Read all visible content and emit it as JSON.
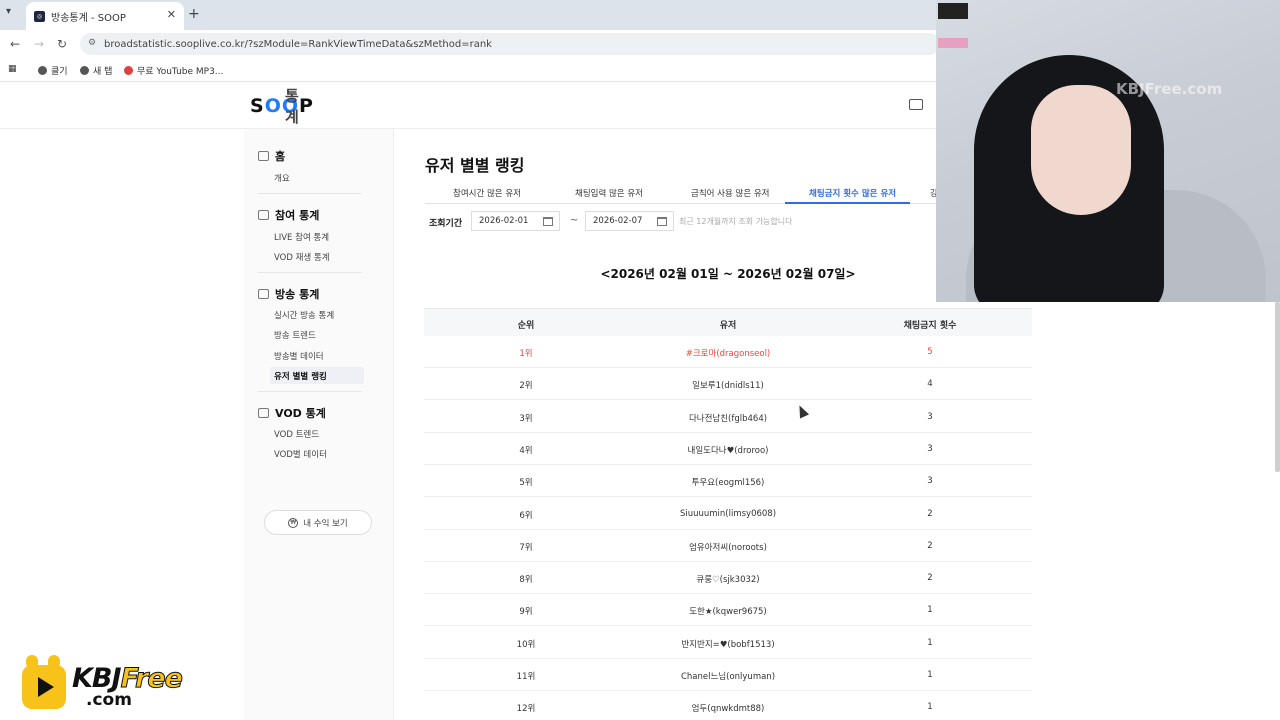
{
  "browser": {
    "tab_title": "방송통계 - SOOP",
    "url": "broadstatistic.sooplive.co.kr/?szModule=RankViewTimeData&szMethod=rank",
    "bookmarks": [
      "앱",
      "클기",
      "새 탭",
      "무료 YouTube MP3..."
    ]
  },
  "site": {
    "logo_text": "SOOP",
    "logo_sub": "통계"
  },
  "sidebar": {
    "sections": [
      {
        "title": "홈",
        "items": [
          "개요"
        ]
      },
      {
        "title": "참여 통계",
        "items": [
          "LIVE 참여 통계",
          "VOD 재생 통계"
        ]
      },
      {
        "title": "방송 통계",
        "items": [
          "실시간 방송 통계",
          "방송 트렌드",
          "방송별 데이터",
          "유저 별별 랭킹"
        ]
      },
      {
        "title": "VOD 통계",
        "items": [
          "VOD 트렌드",
          "VOD별 데이터"
        ]
      }
    ],
    "active_item": "유저 별별 랭킹",
    "revenue_button": "내 수익 보기"
  },
  "main": {
    "title": "유저 별별 랭킹",
    "tabs": [
      "참여시간 많은 유저",
      "채팅입력 많은 유저",
      "금칙어 사용 많은 유저",
      "채팅금지 횟수 많은 유저",
      "강"
    ],
    "active_tab": "채팅금지 횟수 많은 유저",
    "period_label": "조회기간",
    "start_date": "2026-02-01",
    "end_date": "2026-02-07",
    "date_separator": "~",
    "hint": "최근 12개월까지 조회 가능합니다",
    "range_heading": "<2026년 02월 01일 ~ 2026년 02월 07일>",
    "columns": [
      "순위",
      "유저",
      "채팅금지 횟수"
    ],
    "rows": [
      {
        "rank": "1위",
        "user": "#크로마(dragonseol)",
        "count": "5"
      },
      {
        "rank": "2위",
        "user": "일보루1(dnidls11)",
        "count": "4"
      },
      {
        "rank": "3위",
        "user": "다나전남친(fglb464)",
        "count": "3"
      },
      {
        "rank": "4위",
        "user": "내일도다나♥(droroo)",
        "count": "3"
      },
      {
        "rank": "5위",
        "user": "투우요(eogml156)",
        "count": "3"
      },
      {
        "rank": "6위",
        "user": "Siuuuumin(limsy0608)",
        "count": "2"
      },
      {
        "rank": "7위",
        "user": "엄유아저씨(noroots)",
        "count": "2"
      },
      {
        "rank": "8위",
        "user": "큐룽♡(sjk3032)",
        "count": "2"
      },
      {
        "rank": "9위",
        "user": "도한★(kqwer9675)",
        "count": "1"
      },
      {
        "rank": "10위",
        "user": "반지반지=♥(bobf1513)",
        "count": "1"
      },
      {
        "rank": "11위",
        "user": "Chanel느님(onlyuman)",
        "count": "1"
      },
      {
        "rank": "12위",
        "user": "엄두(qnwkdmt88)",
        "count": "1"
      }
    ]
  },
  "overlay": {
    "watermark": "KBJFree.com",
    "badge_brand_a": "KBJ",
    "badge_brand_b": "Free",
    "badge_domain": ".com"
  },
  "colors": {
    "accent": "#2f6de0",
    "first_place": "#e8473d",
    "logo_blue": "#1e7bff",
    "badge_yellow": "#f7c21a"
  },
  "icons": [
    "tab-menu-icon",
    "favicon-icon",
    "close-icon",
    "new-tab-icon",
    "back-icon",
    "forward-icon",
    "reload-icon",
    "site-info-icon",
    "apps-icon",
    "globe-icon",
    "home-icon",
    "participation-icon",
    "broadcast-icon",
    "vod-icon",
    "calendar-icon",
    "camera-icon",
    "play-icon",
    "mouse-cursor-icon"
  ]
}
